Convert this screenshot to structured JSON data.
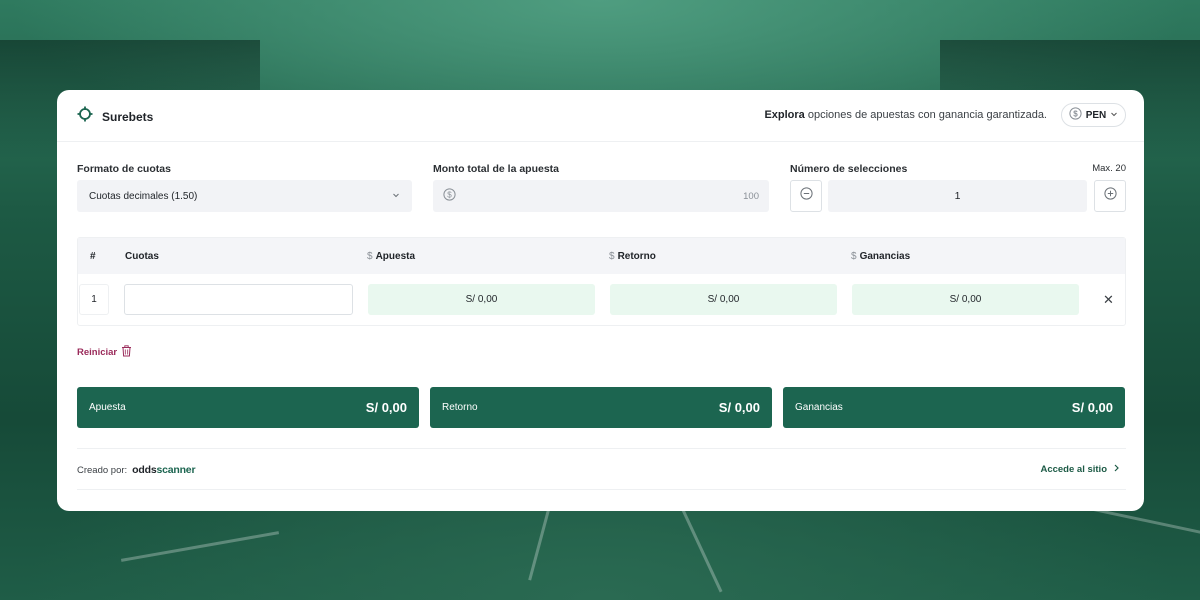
{
  "app": {
    "title": "Surebets"
  },
  "header": {
    "tagline_bold": "Explora",
    "tagline_rest": " opciones de apuestas con ganancia garantizada.",
    "currency": "PEN"
  },
  "form": {
    "odds_format_label": "Formato de cuotas",
    "odds_format_value": "Cuotas decimales (1.50)",
    "total_bet_label": "Monto total de la apuesta",
    "total_bet_value": "100",
    "selections_label": "Número de selecciones",
    "selections_max": "Max. 20",
    "selections_value": "1"
  },
  "table": {
    "headers": {
      "index": "#",
      "odds": "Cuotas",
      "stake": "Apuesta",
      "return": "Retorno",
      "profit": "Ganancias",
      "currency_symbol": "$"
    },
    "rows": [
      {
        "index": "1",
        "odds": "",
        "stake": "S/ 0,00",
        "return": "S/ 0,00",
        "profit": "S/ 0,00"
      }
    ]
  },
  "reset_label": "Reiniciar",
  "summary": [
    {
      "label": "Apuesta",
      "value": "S/ 0,00"
    },
    {
      "label": "Retorno",
      "value": "S/ 0,00"
    },
    {
      "label": "Ganancias",
      "value": "S/ 0,00"
    }
  ],
  "footer": {
    "created_by": "Creado por:",
    "logo_part1": "odds",
    "logo_part2": "scanner",
    "visit_link": "Accede al sitio"
  },
  "colors": {
    "accent": "#1c6550",
    "money_cell": "#e9f8ef",
    "reset": "#9a2a5a"
  },
  "icons": [
    "crosshair-icon",
    "dollar-coin-icon",
    "chevron-down-icon",
    "minus-circle-icon",
    "plus-circle-icon",
    "close-icon",
    "trash-icon",
    "chevron-right-icon"
  ]
}
